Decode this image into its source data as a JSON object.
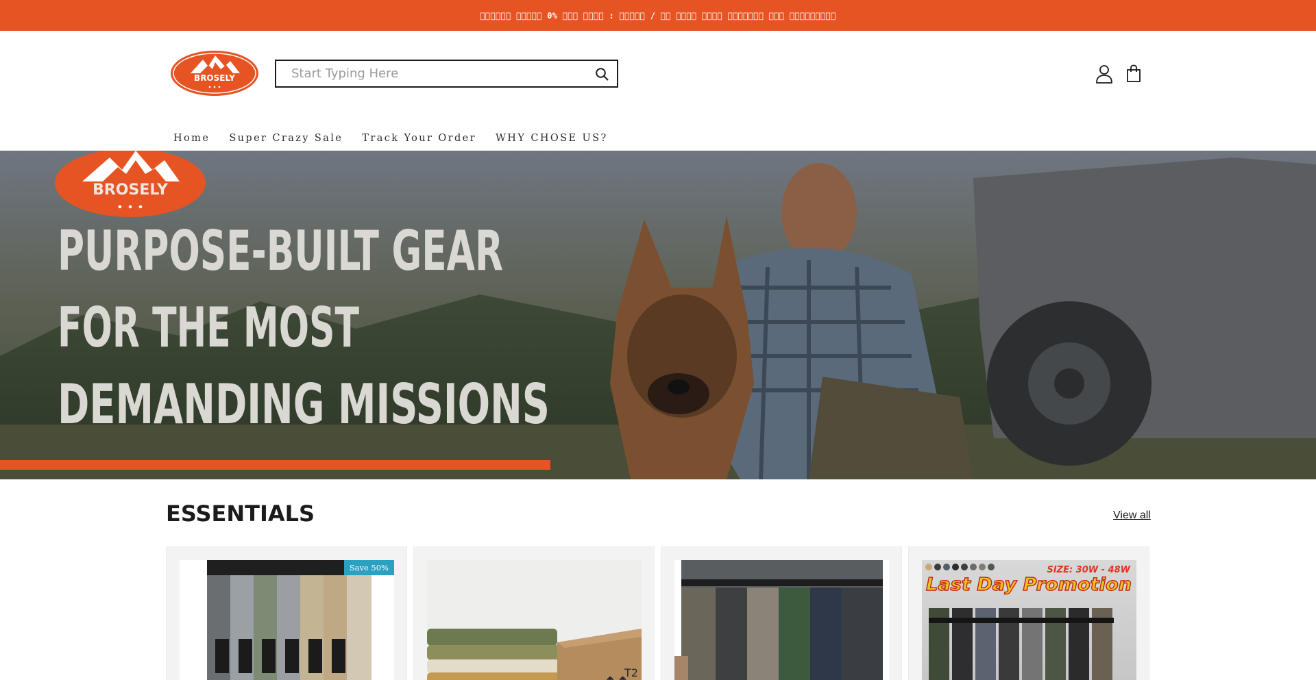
{
  "announcement": {
    "text": "\u0000\u0000\u0000\u0000\u0000\u0000 \u0000\u0000\u0000\u0000\u0000 0% \u0000\u0000\u0000 \u0000\u0000\u0000\u0000 : \u0000\u0000\u0000\u0000\u0000 / \u0000\u0000 \u0000\u0000\u0000\u0000 \u0000\u0000\u0000\u0000 \u0000\u0000\u0000\u0000\u0000\u0000\u0000 \u0000\u0000\u0000 \u0000\u0000\u0000\u0000\u0000\u0000\u0000\u0000\u0000"
  },
  "brand": {
    "name": "BROSELY",
    "accent": "#e65423",
    "badge_color": "#2aa1c1"
  },
  "search": {
    "placeholder": "Start Typing Here",
    "value": "",
    "icon": "search-icon"
  },
  "header_icons": {
    "account": "account-icon",
    "cart": "shopping-bag-icon"
  },
  "nav": {
    "items": [
      {
        "label": "Home"
      },
      {
        "label": "Super Crazy Sale"
      },
      {
        "label": "Track Your Order"
      },
      {
        "label": "WHY CHOSE US?"
      }
    ]
  },
  "hero": {
    "headline_lines": [
      "PURPOSE-BUILT GEAR",
      "FOR THE MOST",
      "DEMANDING MISSIONS"
    ],
    "logo_text": "BROSELY"
  },
  "essentials": {
    "title": "ESSENTIALS",
    "view_all": "View all",
    "products": [
      {
        "badge": "Save 50%"
      },
      {
        "badge": ""
      },
      {
        "badge": ""
      },
      {
        "badge": "",
        "banner_size": "SIZE: 30W - 48W",
        "banner_title": "Last Day Promotion"
      }
    ]
  }
}
